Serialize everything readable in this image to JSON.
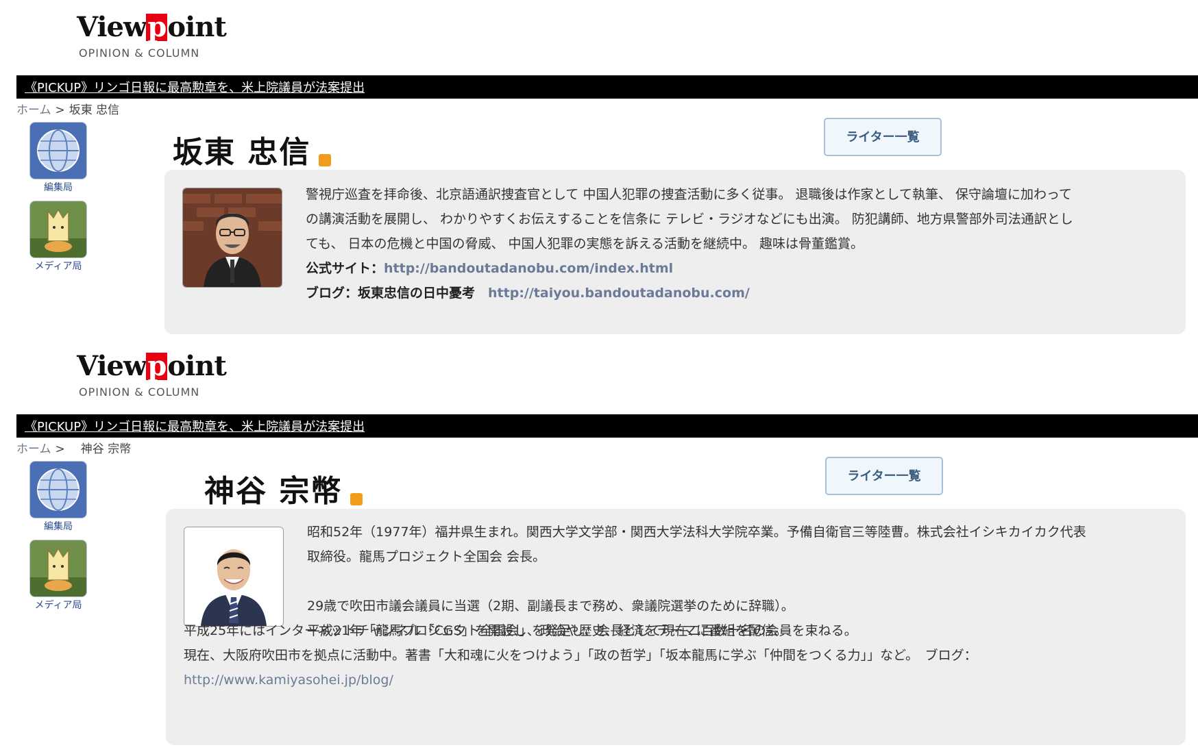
{
  "sections": [
    {
      "logo": {
        "pre": "View",
        "letter": "p",
        "post": "oint",
        "sub": "OPINION & COLUMN"
      },
      "pickup": "《PICKUP》リンゴ日報に最高勲章を、米上院議員が法案提出",
      "breadcrumb": {
        "home": "ホーム",
        "sep": ">",
        "current": "坂東 忠信"
      },
      "side": [
        {
          "label": "編集局"
        },
        {
          "label": "メディア局"
        }
      ],
      "name": "坂東 忠信",
      "writers_button": "ライター一覧",
      "bio_lines": [
        "警視庁巡査を拝命後、北京語通訳捜査官として 中国人犯罪の捜査活動に多く従事。 退職後は作家として執筆、 保守論壇に加わって",
        "の講演活動を展開し、 わかりやすくお伝えすることを信条に テレビ・ラジオなどにも出演。 防犯講師、地方県警部外司法通訳とし",
        "ても、 日本の危機と中国の脅威、 中国人犯罪の実態を訴える活動を継続中。 趣味は骨董鑑賞。"
      ],
      "site": {
        "label": "公式サイト：",
        "url": "http://bandoutadanobu.com/index.html"
      },
      "blog": {
        "label": "ブログ：坂東忠信の日中憂考",
        "url": "http://taiyou.bandoutadanobu.com/"
      }
    },
    {
      "logo": {
        "pre": "View",
        "letter": "p",
        "post": "oint",
        "sub": "OPINION & COLUMN"
      },
      "pickup": "《PICKUP》リンゴ日報に最高勲章を、米上院議員が法案提出",
      "breadcrumb": {
        "home": "ホーム",
        "sep": ">",
        "current": "神谷 宗幣"
      },
      "side": [
        {
          "label": "編集局"
        },
        {
          "label": "メディア局"
        }
      ],
      "name": "神谷 宗幣",
      "writers_button": "ライター一覧",
      "bio_top": [
        "昭和52年（1977年）福井県生まれ。関西大学文学部・関西大学法科大学院卒業。予備自衛官三等陸曹。株式会社イシキカイカク代表",
        "取締役。龍馬プロジェクト全国会 会長。",
        "",
        "29歳で吹田市議会議員に当選（2期、副議長まで務め、衆議院選挙のために辞職）。",
        "平成21年「龍馬プロジェクト全国会」を発足し、会長として現在二百数十名の会員を束ねる。"
      ],
      "bio_bottom": [
        "平成25年にはインターネットチャンネル「CGS」を開設し、政治や歴史、経済をテーマに番組を配信。",
        "現在、大阪府吹田市を拠点に活動中。著書「大和魂に火をつけよう」「政の哲学」「坂本龍馬に学ぶ「仲間をつくる力」」など。　ブログ："
      ],
      "blog_url": "http://www.kamiyasohei.jp/blog/"
    }
  ],
  "colors": {
    "accent_red": "#e60012",
    "link": "#6b7a96",
    "box_bg": "#eeeeee",
    "rss": "#f29b1d"
  }
}
